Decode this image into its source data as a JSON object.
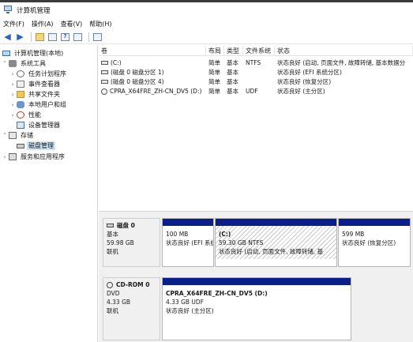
{
  "window": {
    "title": "计算机管理"
  },
  "menu": [
    "文件(F)",
    "操作(A)",
    "查看(V)",
    "帮助(H)"
  ],
  "toolbar": {
    "buttons": [
      "back-icon",
      "forward-icon",
      "up-folder-icon",
      "show-hide-tree-icon",
      "help-icon",
      "properties-icon"
    ]
  },
  "tree": {
    "root": "计算机管理(本地)",
    "system_tools": "系统工具",
    "task_scheduler": "任务计划程序",
    "event_viewer": "事件查看器",
    "shared_folders": "共享文件夹",
    "local_users": "本地用户和组",
    "performance": "性能",
    "device_manager": "设备管理器",
    "storage": "存储",
    "disk_management": "磁盘管理",
    "services": "服务和应用程序"
  },
  "volume_list": {
    "headers": [
      "卷",
      "布局",
      "类型",
      "文件系统",
      "状态"
    ],
    "rows": [
      [
        "(C:)",
        "简单",
        "基本",
        "NTFS",
        "状态良好 (启动, 页面文件, 故障转储, 基本数据分"
      ],
      [
        "(磁盘 0 磁盘分区 1)",
        "简单",
        "基本",
        "",
        "状态良好 (EFI 系统分区)"
      ],
      [
        "(磁盘 0 磁盘分区 4)",
        "简单",
        "基本",
        "",
        "状态良好 (恢复分区)"
      ],
      [
        "CPRA_X64FRE_ZH-CN_DV5 (D:)",
        "简单",
        "基本",
        "UDF",
        "状态良好 (主分区)"
      ]
    ]
  },
  "disks": {
    "disk0": {
      "name": "磁盘 0",
      "type": "基本",
      "size": "59.98 GB",
      "status": "联机",
      "partitions": [
        {
          "size": "100 MB",
          "status": "状态良好 (EFI 系统"
        },
        {
          "label": "(C:)",
          "size": "59.30 GB NTFS",
          "status": "状态良好 (启动, 页面文件, 故障转储, 基"
        },
        {
          "size": "599 MB",
          "status": "状态良好 (恢复分区)"
        }
      ]
    },
    "cdrom0": {
      "name": "CD-ROM 0",
      "type": "DVD",
      "size": "4.33 GB",
      "status": "联机",
      "partition": {
        "label": "CPRA_X64FRE_ZH-CN_DV5  (D:)",
        "size": "4.33 GB UDF",
        "status": "状态良好 (主分区)"
      }
    }
  },
  "colors": {
    "partition_bar": "#0a1f8a",
    "selection": "#cce4f7"
  }
}
